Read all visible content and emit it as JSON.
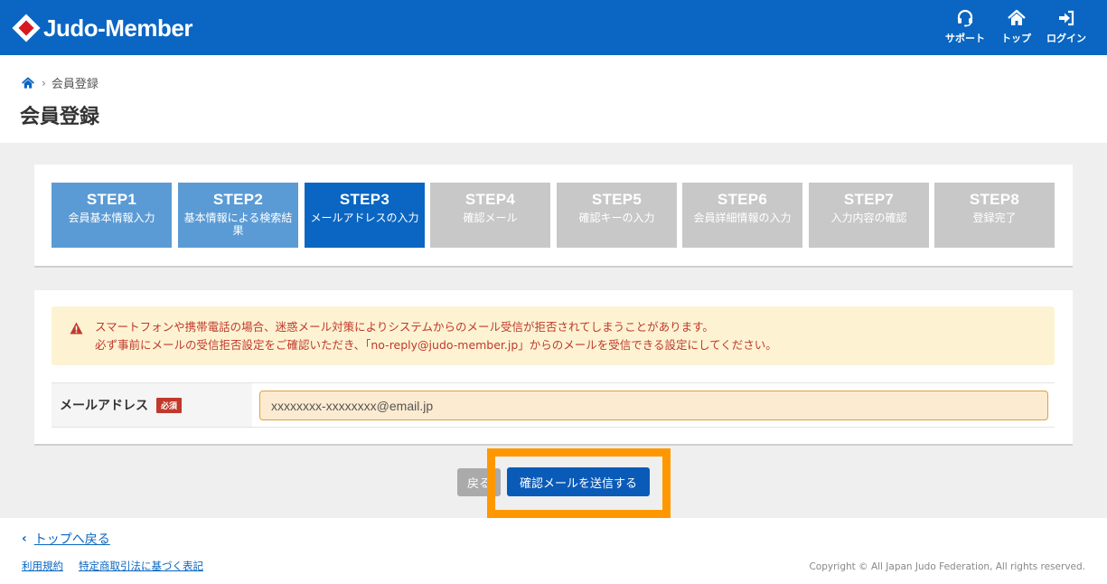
{
  "header": {
    "logo_text": "Judo-Member",
    "nav": [
      {
        "label": "サポート",
        "icon": "headset-icon"
      },
      {
        "label": "トップ",
        "icon": "home-icon"
      },
      {
        "label": "ログイン",
        "icon": "login-icon"
      }
    ]
  },
  "breadcrumb": {
    "current": "会員登録"
  },
  "page_title": "会員登録",
  "steps": [
    {
      "number": "STEP1",
      "label": "会員基本情報入力",
      "state": "done"
    },
    {
      "number": "STEP2",
      "label": "基本情報による検索結果",
      "state": "done"
    },
    {
      "number": "STEP3",
      "label": "メールアドレスの入力",
      "state": "current"
    },
    {
      "number": "STEP4",
      "label": "確認メール",
      "state": "todo"
    },
    {
      "number": "STEP5",
      "label": "確認キーの入力",
      "state": "todo"
    },
    {
      "number": "STEP6",
      "label": "会員詳細情報の入力",
      "state": "todo"
    },
    {
      "number": "STEP7",
      "label": "入力内容の確認",
      "state": "todo"
    },
    {
      "number": "STEP8",
      "label": "登録完了",
      "state": "todo"
    }
  ],
  "alert": {
    "line1": "スマートフォンや携帯電話の場合、迷惑メール対策によりシステムからのメール受信が拒否されてしまうことがあります。",
    "line2": "必ず事前にメールの受信拒否設定をご確認いただき、「no-reply@judo-member.jp」からのメールを受信できる設定にしてください。"
  },
  "form": {
    "email_label": "メールアドレス",
    "required_badge": "必須",
    "email_value": "xxxxxxxx-xxxxxxxx@email.jp"
  },
  "buttons": {
    "back": "戻る",
    "send": "確認メールを送信する"
  },
  "footer": {
    "back_to_top": "トップへ戻る",
    "links": [
      "利用規約",
      "特定商取引法に基づく表記"
    ],
    "copyright": "Copyright © All Japan Judo Federation, All rights reserved."
  },
  "colors": {
    "brand": "#0a66c2",
    "step_done": "#5b9bd5",
    "step_current": "#0a66c2",
    "step_todo": "#c8c8c8",
    "highlight": "#ff9800",
    "alert_text": "#c0392b"
  }
}
